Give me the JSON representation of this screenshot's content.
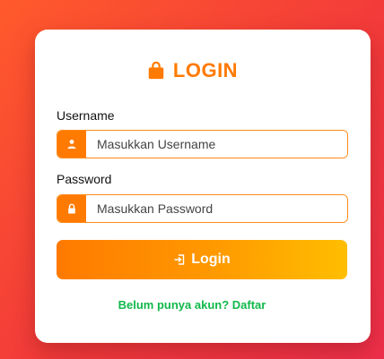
{
  "form": {
    "title": "LOGIN",
    "username_label": "Username",
    "username_placeholder": "Masukkan Username",
    "password_label": "Password",
    "password_placeholder": "Masukkan Password",
    "login_button": "Login",
    "register_prompt": "Belum punya akun?",
    "register_link": "Daftar"
  },
  "icons": {
    "title": "shopping-bag-icon",
    "username": "user-icon",
    "password": "lock-icon",
    "login": "sign-in-icon"
  },
  "colors": {
    "accent": "#ff7a00",
    "link": "#10b84a",
    "background": "#f23a3a"
  }
}
